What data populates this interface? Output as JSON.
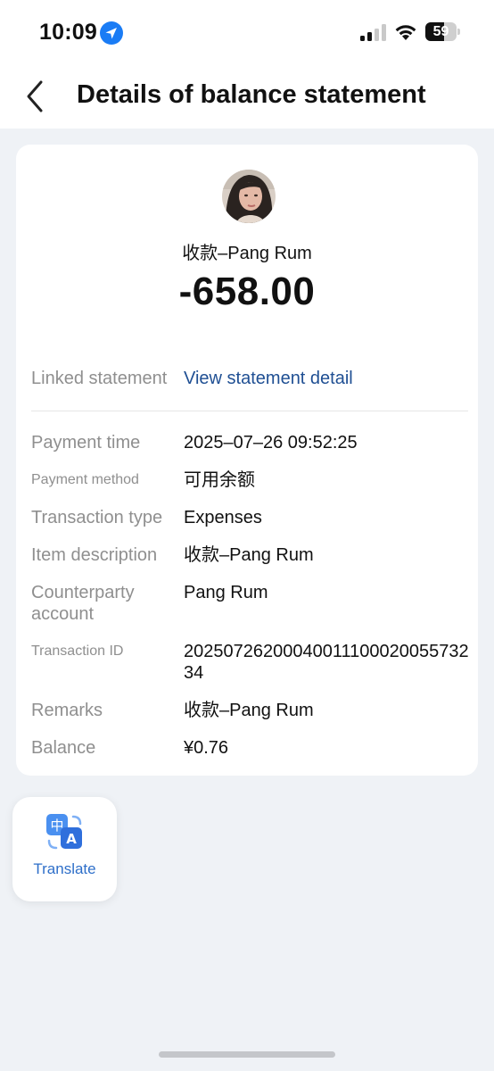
{
  "status_bar": {
    "time": "10:09",
    "battery": "59",
    "battery_level": 0.59,
    "icons": [
      "location-arrow-icon",
      "signal-icon",
      "wifi-icon",
      "battery-icon"
    ]
  },
  "nav": {
    "title": "Details of balance statement",
    "back_icon": "chevron-left-icon"
  },
  "summary": {
    "payee": "收款–Pang Rum",
    "amount": "-658.00"
  },
  "linked": {
    "label": "Linked statement",
    "link_text": "View statement detail"
  },
  "details": [
    {
      "label": "Payment time",
      "value": "2025–07–26 09:52:25"
    },
    {
      "label": "Payment method",
      "value": "可用余额"
    },
    {
      "label": "Transaction type",
      "value": "Expenses"
    },
    {
      "label": "Item description",
      "value": "收款–Pang Rum"
    },
    {
      "label": "Counterparty account",
      "value": "Pang Rum"
    },
    {
      "label": "Transaction ID",
      "value": "2025072620004001110002005573234"
    },
    {
      "label": "Remarks",
      "value": "收款–Pang Rum"
    },
    {
      "label": "Balance",
      "value": "¥0.76"
    }
  ],
  "translate": {
    "label": "Translate",
    "icon": "translate-icon"
  },
  "colors": {
    "link": "#1f4f93",
    "accent": "#2e6fc9",
    "background": "#eff2f6"
  }
}
